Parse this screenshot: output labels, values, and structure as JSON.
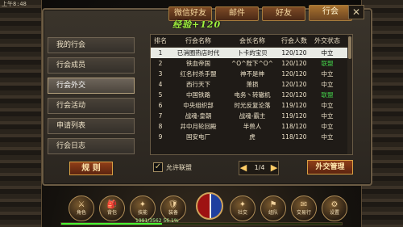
{
  "status_bar": {
    "time": "上午8:48"
  },
  "tabs": [
    "微信好友",
    "邮件",
    "好友",
    "行会"
  ],
  "active_tab": "行会",
  "close_glyph": "✕",
  "experience": "经验+120",
  "left_menu": [
    "我的行会",
    "行会成员",
    "行会外交",
    "行会活动",
    "申请列表",
    "行会日志"
  ],
  "active_menu": "行会外交",
  "rules_button": "规 则",
  "table": {
    "headers": [
      "排名",
      "行会名称",
      "会长名称",
      "行会人数",
      "外交状态"
    ],
    "rows": [
      {
        "rank": "1",
        "guild": "已消圈热店时代",
        "leader": "卜卡的宝贝",
        "members": "120/120",
        "status": "中立",
        "selected": true
      },
      {
        "rank": "2",
        "guild": "铁血帝国",
        "leader": "^O^陛下^O^",
        "members": "120/120",
        "status": "联盟"
      },
      {
        "rank": "3",
        "guild": "红名村杀手盟",
        "leader": "神不是神",
        "members": "120/120",
        "status": "中立"
      },
      {
        "rank": "4",
        "guild": "西行天下",
        "leader": "萧损",
        "members": "120/120",
        "status": "中立"
      },
      {
        "rank": "5",
        "guild": "中国铁路",
        "leader": "电务丶转辙机",
        "members": "120/120",
        "status": "联盟"
      },
      {
        "rank": "6",
        "guild": "中央组织部",
        "leader": "时光反复沦落",
        "members": "119/120",
        "status": "中立"
      },
      {
        "rank": "7",
        "guild": "战魂-皇朝",
        "leader": "战魂-霸主",
        "members": "119/120",
        "status": "中立"
      },
      {
        "rank": "8",
        "guild": "井中月轮回殿",
        "leader": "半兽人",
        "members": "118/120",
        "status": "中立"
      },
      {
        "rank": "9",
        "guild": "国安电厂",
        "leader": "虎",
        "members": "118/120",
        "status": "中立"
      }
    ]
  },
  "checkbox": {
    "checked": true,
    "mark": "✓",
    "label": "允许联盟"
  },
  "pager": {
    "text": "1/4",
    "prev": "◀",
    "next": "▶"
  },
  "diplomacy_button": "外交管理",
  "hotbar": [
    {
      "glyph": "⚔",
      "label": "角色"
    },
    {
      "glyph": "🎒",
      "label": "背包"
    },
    {
      "glyph": "✦",
      "label": "技能"
    },
    {
      "glyph": "🛡",
      "label": "装备"
    },
    {
      "glyph": "✦",
      "label": "社交"
    },
    {
      "glyph": "⚑",
      "label": "组队"
    },
    {
      "glyph": "✉",
      "label": "交易行"
    },
    {
      "glyph": "⚙",
      "label": "设置"
    }
  ],
  "xp": {
    "text": "1991/3562 56.1%",
    "progress": 0.36
  },
  "colors": {
    "green_status": "#43d24a",
    "neutral_status": "#efe4cb"
  }
}
